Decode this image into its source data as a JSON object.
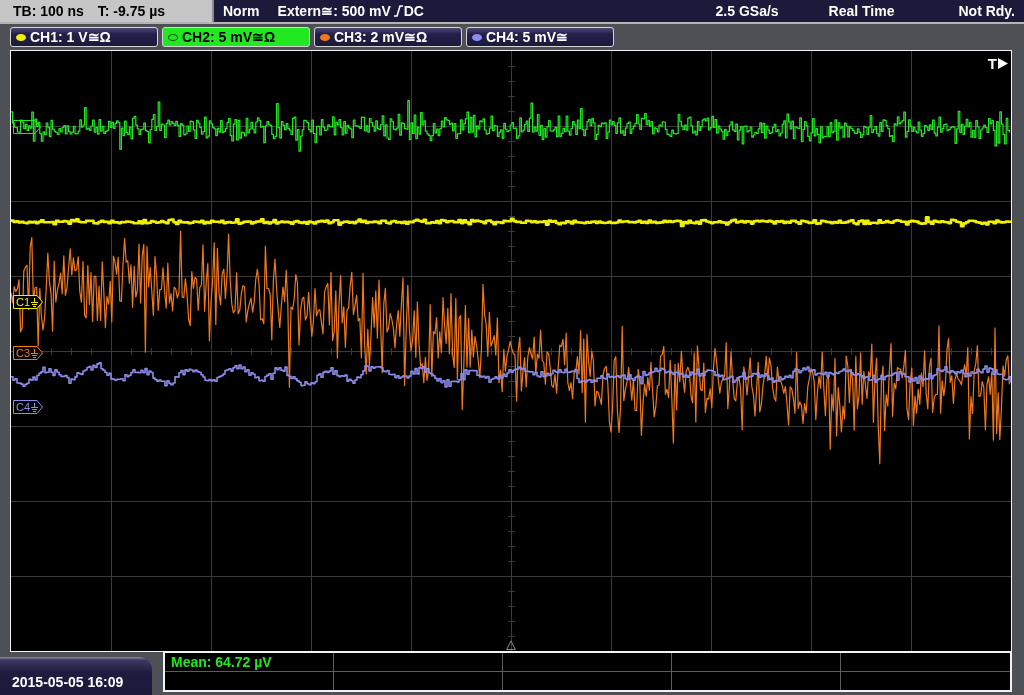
{
  "header": {
    "timebase": "TB: 100 ns",
    "trigger_time": "T: -9.75 µs",
    "trigger_mode": "Norm",
    "trigger_source": "Extern≅: 500 mV",
    "trigger_coupling": "DC",
    "sample_rate": "2.5 GSa/s",
    "acquisition_mode": "Real Time",
    "status": "Not Rdy."
  },
  "channels": [
    {
      "label": "CH1: 1 V≅Ω",
      "color": "#f0f000",
      "selected": false,
      "marker": "C1"
    },
    {
      "label": "CH2: 5 mV≅Ω",
      "color": "#22e822",
      "selected": true
    },
    {
      "label": "CH3: 2 mV≅Ω",
      "color": "#f07820",
      "selected": false,
      "marker": "C3"
    },
    {
      "label": "CH4: 5 mV≅",
      "color": "#8c8cec",
      "selected": false,
      "marker": "C4"
    }
  ],
  "display": {
    "trigger_label": "T"
  },
  "measurements": [
    {
      "text": "Mean: 64.72 µV"
    }
  ],
  "footer": {
    "datetime": "2015-05-05 16:09"
  }
}
